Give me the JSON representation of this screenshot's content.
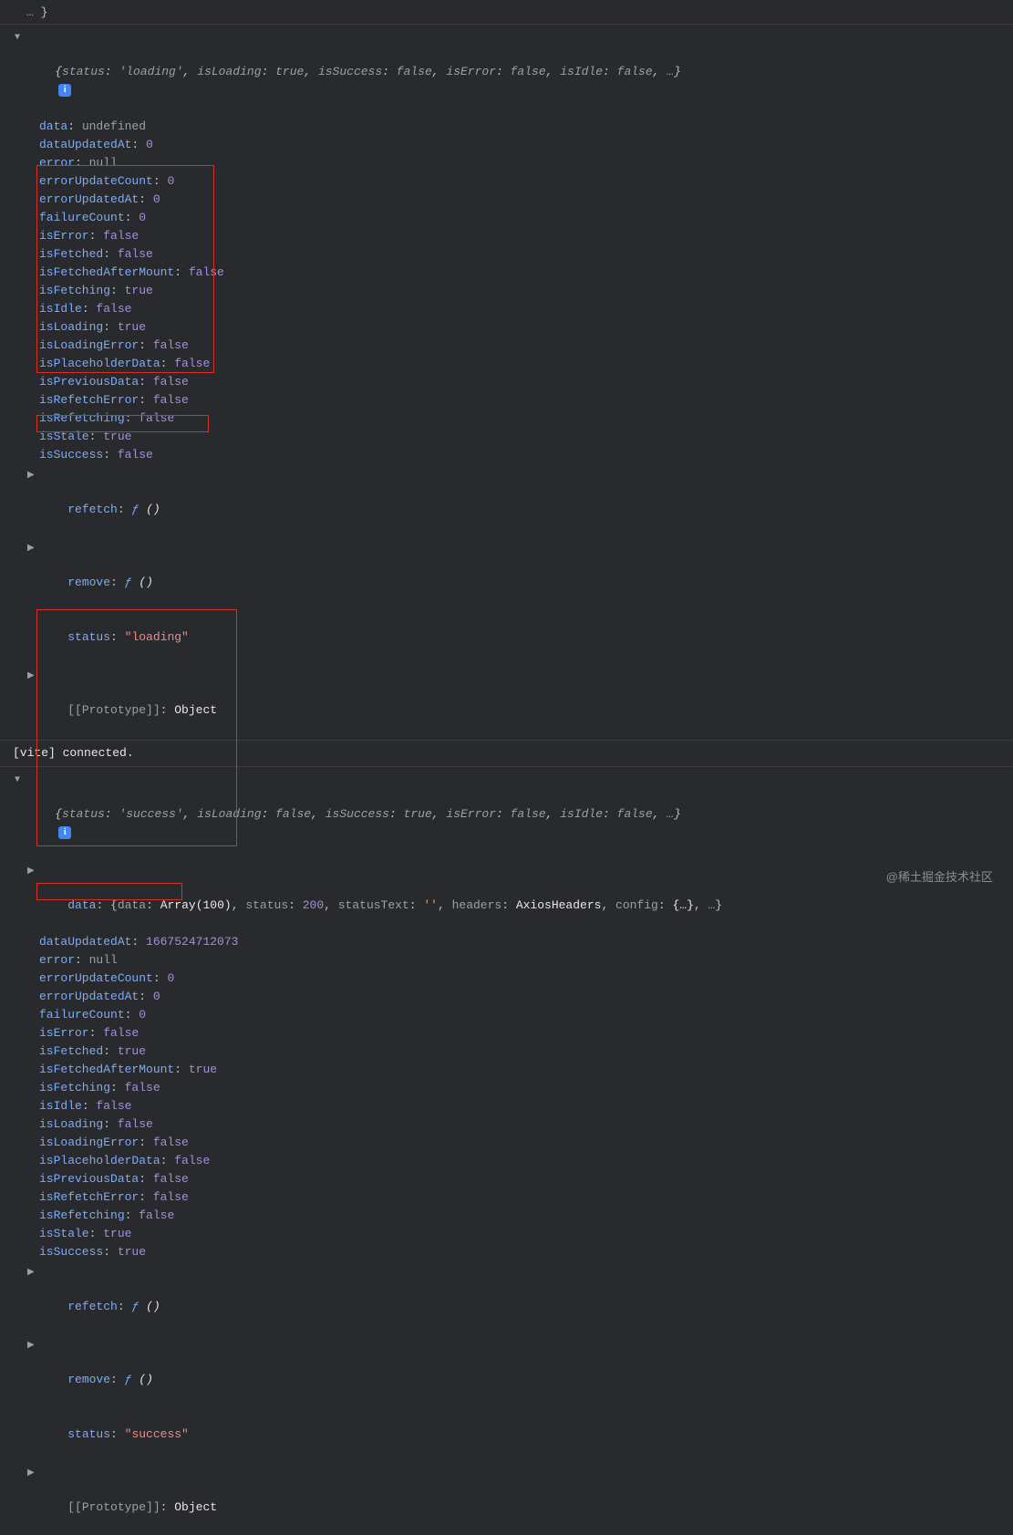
{
  "summary_line_top_truncated": "…",
  "obj1": {
    "summary": {
      "status_key": "status",
      "status_val": "'loading'",
      "isLoading_key": "isLoading",
      "isLoading_val": "true",
      "isSuccess_key": "isSuccess",
      "isSuccess_val": "false",
      "isError_key": "isError",
      "isError_val": "false",
      "isIdle_key": "isIdle",
      "isIdle_val": "false",
      "rest": "…"
    },
    "props": [
      {
        "k": "data",
        "v": "undefined",
        "cls": "gray"
      },
      {
        "k": "dataUpdatedAt",
        "v": "0",
        "cls": "num"
      },
      {
        "k": "error",
        "v": "null",
        "cls": "gray"
      },
      {
        "k": "errorUpdateCount",
        "v": "0",
        "cls": "num"
      },
      {
        "k": "errorUpdatedAt",
        "v": "0",
        "cls": "num"
      },
      {
        "k": "failureCount",
        "v": "0",
        "cls": "num"
      },
      {
        "k": "isError",
        "v": "false",
        "cls": "bool"
      },
      {
        "k": "isFetched",
        "v": "false",
        "cls": "bool"
      },
      {
        "k": "isFetchedAfterMount",
        "v": "false",
        "cls": "bool"
      },
      {
        "k": "isFetching",
        "v": "true",
        "cls": "bool"
      },
      {
        "k": "isIdle",
        "v": "false",
        "cls": "bool"
      },
      {
        "k": "isLoading",
        "v": "true",
        "cls": "bool"
      },
      {
        "k": "isLoadingError",
        "v": "false",
        "cls": "bool"
      },
      {
        "k": "isPlaceholderData",
        "v": "false",
        "cls": "bool"
      },
      {
        "k": "isPreviousData",
        "v": "false",
        "cls": "bool"
      },
      {
        "k": "isRefetchError",
        "v": "false",
        "cls": "bool"
      },
      {
        "k": "isRefetching",
        "v": "false",
        "cls": "bool"
      },
      {
        "k": "isStale",
        "v": "true",
        "cls": "bool"
      },
      {
        "k": "isSuccess",
        "v": "false",
        "cls": "bool"
      }
    ],
    "refetch": {
      "k": "refetch",
      "fn": "ƒ",
      "args": "()"
    },
    "remove": {
      "k": "remove",
      "fn": "ƒ",
      "args": "()"
    },
    "status": {
      "k": "status",
      "v": "\"loading\""
    },
    "proto": {
      "k": "[[Prototype]]",
      "v": "Object"
    }
  },
  "vite_msg": {
    "prefix": "[vite]",
    "text": " connected."
  },
  "obj2": {
    "summary": {
      "status_key": "status",
      "status_val": "'success'",
      "isLoading_key": "isLoading",
      "isLoading_val": "false",
      "isSuccess_key": "isSuccess",
      "isSuccess_val": "true",
      "isError_key": "isError",
      "isError_val": "false",
      "isIdle_key": "isIdle",
      "isIdle_val": "false",
      "rest": "…"
    },
    "data_line": {
      "k": "data",
      "data_k": "data",
      "data_v": "Array(100)",
      "status_k": "status",
      "status_v": "200",
      "statusText_k": "statusText",
      "statusText_v": "''",
      "headers_k": "headers",
      "headers_v": "AxiosHeaders",
      "config_k": "config",
      "config_v": "{…}",
      "rest": "…"
    },
    "props": [
      {
        "k": "dataUpdatedAt",
        "v": "1667524712073",
        "cls": "num"
      },
      {
        "k": "error",
        "v": "null",
        "cls": "gray"
      },
      {
        "k": "errorUpdateCount",
        "v": "0",
        "cls": "num"
      },
      {
        "k": "errorUpdatedAt",
        "v": "0",
        "cls": "num"
      },
      {
        "k": "failureCount",
        "v": "0",
        "cls": "num"
      },
      {
        "k": "isError",
        "v": "false",
        "cls": "bool"
      },
      {
        "k": "isFetched",
        "v": "true",
        "cls": "bool"
      },
      {
        "k": "isFetchedAfterMount",
        "v": "true",
        "cls": "bool"
      },
      {
        "k": "isFetching",
        "v": "false",
        "cls": "bool"
      },
      {
        "k": "isIdle",
        "v": "false",
        "cls": "bool"
      },
      {
        "k": "isLoading",
        "v": "false",
        "cls": "bool"
      },
      {
        "k": "isLoadingError",
        "v": "false",
        "cls": "bool"
      },
      {
        "k": "isPlaceholderData",
        "v": "false",
        "cls": "bool"
      },
      {
        "k": "isPreviousData",
        "v": "false",
        "cls": "bool"
      },
      {
        "k": "isRefetchError",
        "v": "false",
        "cls": "bool"
      },
      {
        "k": "isRefetching",
        "v": "false",
        "cls": "bool"
      },
      {
        "k": "isStale",
        "v": "true",
        "cls": "bool"
      },
      {
        "k": "isSuccess",
        "v": "true",
        "cls": "bool"
      }
    ],
    "refetch": {
      "k": "refetch",
      "fn": "ƒ",
      "args": "()"
    },
    "remove": {
      "k": "remove",
      "fn": "ƒ",
      "args": "()"
    },
    "status": {
      "k": "status",
      "v": "\"success\""
    },
    "proto": {
      "k": "[[Prototype]]",
      "v": "Object"
    }
  },
  "watermark": "@稀土掘金技术社区"
}
